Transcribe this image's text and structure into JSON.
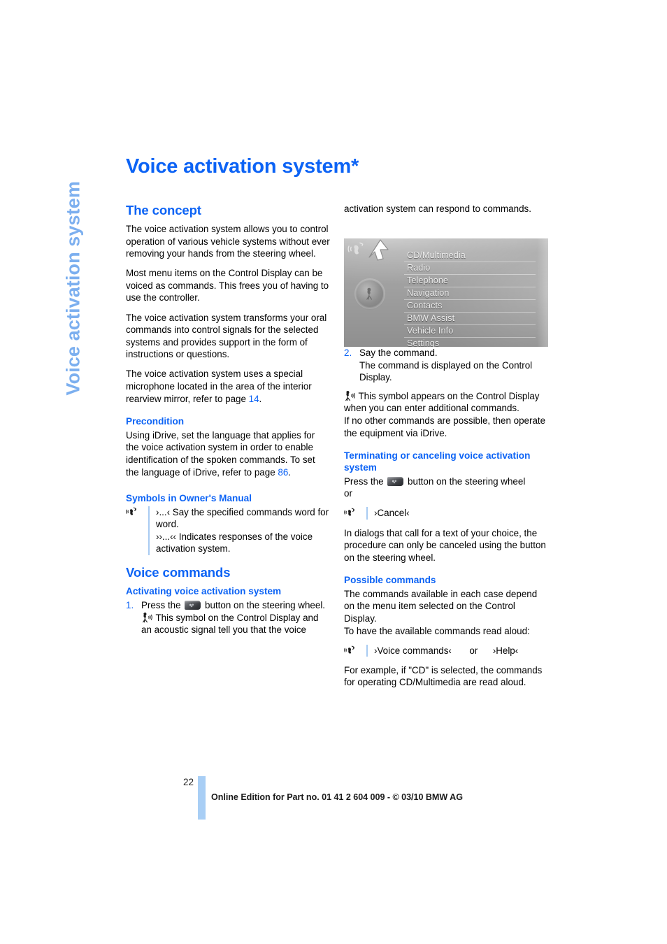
{
  "sidebar": {
    "chapter_label": "Voice activation system"
  },
  "page": {
    "title": "Voice activation system*",
    "number": "22",
    "footer": "Online Edition for Part no. 01 41 2 604 009 - © 03/10 BMW AG"
  },
  "left_column": {
    "concept_heading": "The concept",
    "concept_p1": "The voice activation system allows you to control operation of various vehicle systems without ever removing your hands from the steering wheel.",
    "concept_p2": "Most menu items on the Control Display can be voiced as commands. This frees you of having to use the controller.",
    "concept_p3": "The voice activation system transforms your oral commands into control signals for the selected systems and provides support in the form of instructions or questions.",
    "concept_p4_before": "The voice activation system uses a special microphone located in the area of the interior rearview mirror, refer to page ",
    "concept_p4_ref": "14",
    "concept_p4_after": ".",
    "precondition_heading": "Precondition",
    "precondition_before": "Using iDrive, set the language that applies for the voice activation system in order to enable identification of the spoken commands. To set the language of iDrive, refer to page ",
    "precondition_ref": "86",
    "precondition_after": ".",
    "symbols_heading": "Symbols in Owner's Manual",
    "symbols_line1": "›...‹ Say the specified commands word for word.",
    "symbols_line2": "››...‹‹ Indicates responses of the voice activation system.",
    "voice_commands_heading": "Voice commands",
    "activating_heading": "Activating voice activation system",
    "step1_num": "1.",
    "step1_before": "Press the",
    "step1_after": "button on the steering wheel.",
    "step1_note": "This symbol on the Control Display and an acoustic signal tell you that the voice"
  },
  "right_column": {
    "continued_text": "activation system can respond to commands.",
    "step2_num": "2.",
    "step2_line1": "Say the command.",
    "step2_line2": "The command is displayed on the Control Display.",
    "symbol_note_1": "This symbol appears on the Control Display when you can enter additional commands.",
    "symbol_note_2": "If no other commands are possible, then operate the equipment via iDrive.",
    "terminating_heading": "Terminating or canceling voice activation system",
    "terminating_before": "Press the",
    "terminating_after": "button on the steering wheel",
    "terminating_or": "or",
    "cancel_command": "›Cancel‹",
    "terminating_note": "In dialogs that call for a text of your choice, the procedure can only be canceled using the button on the steering wheel.",
    "possible_heading": "Possible commands",
    "possible_p1": "The commands available in each case depend on the menu item selected on the Control Display.",
    "possible_p2": "To have the available commands read aloud:",
    "cmd_voice_commands": "›Voice commands‹",
    "cmd_or": "or",
    "cmd_help": "›Help‹",
    "possible_p3": "For example, if \"CD\" is selected, the commands for operating CD/Multimedia are read aloud."
  },
  "figure": {
    "caption_alt": "iDrive Control Display main menu",
    "menu_items": [
      "CD/Multimedia",
      "Radio",
      "Telephone",
      "Navigation",
      "Contacts",
      "BMW Assist",
      "Vehicle Info",
      "Settings"
    ]
  },
  "colors": {
    "heading_blue": "#0C63F5",
    "tab_blue": "#7CAFEF",
    "rule_blue": "#A8CBF2",
    "footer_bar_blue": "#A8CEF5"
  }
}
